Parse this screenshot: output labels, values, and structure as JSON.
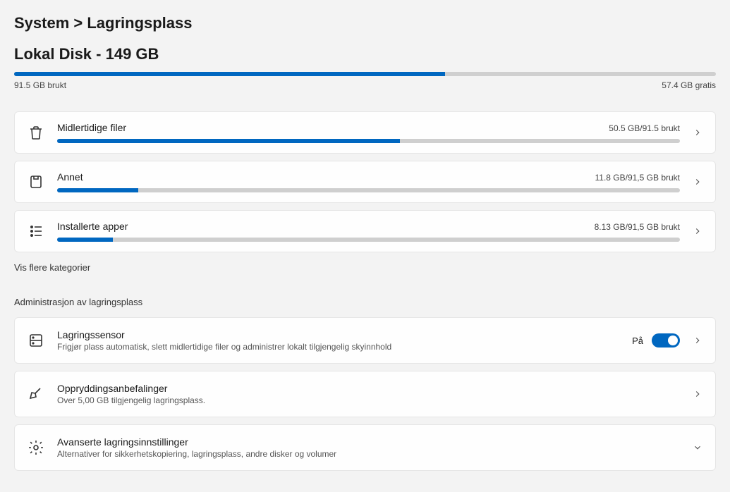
{
  "breadcrumb": "System &gt;  Lagringsplass",
  "disk": {
    "title": "Lokal  Disk - 149 GB",
    "used_label": "91.5 GB brukt",
    "free_label": "57.4 GB gratis",
    "percent": 61.4
  },
  "categories": [
    {
      "icon": "trash-icon",
      "title": "Midlertidige filer",
      "usage": "50.5 GB/91.5 brukt",
      "percent": 55
    },
    {
      "icon": "package-icon",
      "title": "Annet",
      "usage": "11.8 GB/91,5 GB brukt",
      "percent": 13
    },
    {
      "icon": "apps-icon",
      "title": "Installerte apper",
      "usage": "8.13 GB/91,5 GB brukt",
      "percent": 9
    }
  ],
  "show_more": "Vis flere kategorier",
  "mgmt_header": "Administrasjon av lagringsplass",
  "sensor": {
    "title": "Lagringssensor",
    "sub": "Frigjør plass automatisk, slett midlertidige filer og administrer lokalt tilgjengelig skyinnhold",
    "state": "På"
  },
  "cleanup": {
    "title": "Oppryddingsanbefalinger",
    "sub": "Over 5,00 GB tilgjengelig lagringsplass."
  },
  "advanced": {
    "title": "Avanserte lagringsinnstillinger",
    "sub": "Alternativer for sikkerhetskopiering, lagringsplass, andre disker og volumer"
  }
}
